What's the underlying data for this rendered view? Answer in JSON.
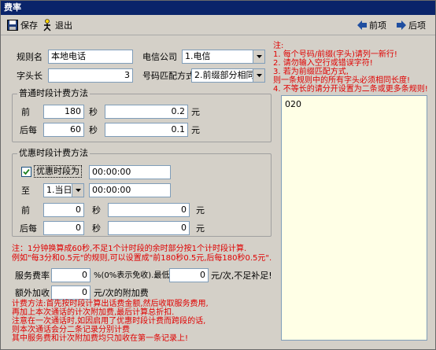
{
  "window": {
    "title": "费率"
  },
  "toolbar": {
    "save": "保存",
    "exit": "退出",
    "prev": "前项",
    "next": "后项"
  },
  "form": {
    "rule_name_label": "规则名",
    "rule_name_value": "本地电话",
    "carrier_label": "电信公司",
    "carrier_value": "1.电信",
    "prefix_len_label": "字头长",
    "prefix_len_value": "3",
    "match_label": "号码匹配方式",
    "match_value": "2.前缀部分相同"
  },
  "normal": {
    "title": "普通时段计费方法",
    "first_label": "前",
    "first_seconds": "180",
    "first_price": "0.2",
    "after_label": "后每",
    "after_seconds": "60",
    "after_price": "0.1",
    "sec_unit": "秒",
    "yuan_unit": "元"
  },
  "discount": {
    "title": "优惠时段计费方法",
    "checkbox_label": "优惠时段为",
    "start_time": "00:00:00",
    "to_label": "至",
    "day_value": "1.当日",
    "end_time": "00:00:00",
    "first_label": "前",
    "first_seconds": "0",
    "first_price": "0",
    "after_label": "后每",
    "after_seconds": "0",
    "after_price": "0",
    "sec_unit": "秒",
    "yuan_unit": "元"
  },
  "note1": {
    "line1": "注：1分钟换算成60秒,不足1个计时段的余时部分按1个计时段计算.",
    "line2": "例如\"每3分和0.5元\"的规则,可以设置成\"前180秒0.5元,后每180秒0.5元\"."
  },
  "fees": {
    "service_label": "服务费率",
    "service_value": "0",
    "service_suffix": "%(0%表示免收).最低",
    "min_value": "0",
    "min_suffix": "元/次,不足补足!",
    "extra_label": "额外加收",
    "extra_value": "0",
    "extra_suffix": "元/次的附加费"
  },
  "note2": {
    "line1": "计费方法:首先按时段计算出话费金额,然后收取服务费用,",
    "line2": "再加上本次通话的计次附加费,最后计算总折扣.",
    "line3": "注意在一次通话时,如因启用了优惠时段计费而跨段的话,",
    "line4": "则本次通话会分二条记录分别计费",
    "line5": "其中服务费和计次附加费均只加收在第一条记录上!"
  },
  "right_note": {
    "head": "注:",
    "l1": "1. 每个号码/前缀(字头)请列一新行!",
    "l2": "2. 请勿输入空行或错误字符!",
    "l3": "3. 若为前缀匹配方式,",
    "l4": "    则一条规则中的所有字头必须相同长度!",
    "l5": "4. 不等长的请分开设置为二条或更多条规则!"
  },
  "numbers": {
    "content": "020"
  }
}
